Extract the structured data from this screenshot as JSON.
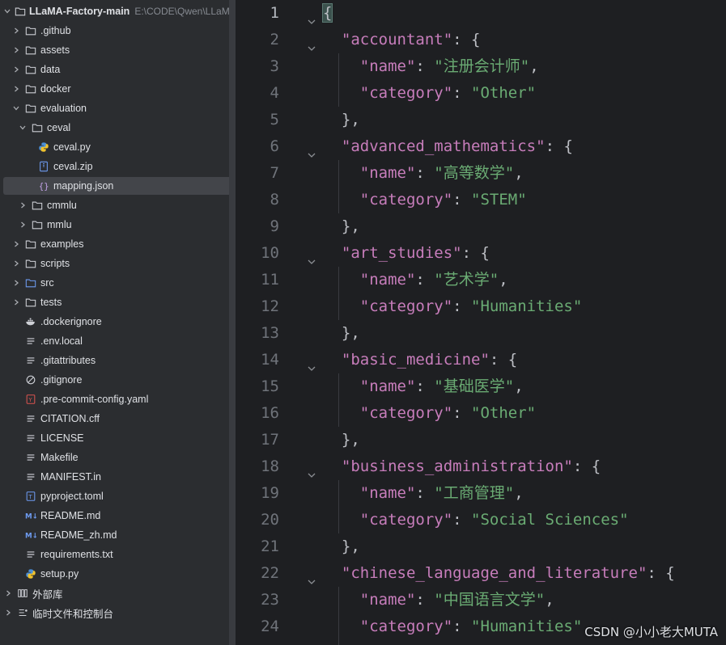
{
  "project": {
    "name": "LLaMA-Factory-main",
    "path": "E:\\CODE\\Qwen\\LLaMA"
  },
  "tree": [
    {
      "label": ".github",
      "type": "folder",
      "depth": 0,
      "expanded": false
    },
    {
      "label": "assets",
      "type": "folder",
      "depth": 0,
      "expanded": false
    },
    {
      "label": "data",
      "type": "folder",
      "depth": 0,
      "expanded": false
    },
    {
      "label": "docker",
      "type": "folder",
      "depth": 0,
      "expanded": false
    },
    {
      "label": "evaluation",
      "type": "folder",
      "depth": 0,
      "expanded": true
    },
    {
      "label": "ceval",
      "type": "folder",
      "depth": 1,
      "expanded": true
    },
    {
      "label": "ceval.py",
      "type": "python",
      "depth": 2
    },
    {
      "label": "ceval.zip",
      "type": "zip",
      "depth": 2
    },
    {
      "label": "mapping.json",
      "type": "json",
      "depth": 2,
      "selected": true
    },
    {
      "label": "cmmlu",
      "type": "folder",
      "depth": 1,
      "expanded": false
    },
    {
      "label": "mmlu",
      "type": "folder",
      "depth": 1,
      "expanded": false
    },
    {
      "label": "examples",
      "type": "folder",
      "depth": 0,
      "expanded": false
    },
    {
      "label": "scripts",
      "type": "folder",
      "depth": 0,
      "expanded": false
    },
    {
      "label": "src",
      "type": "folder-src",
      "depth": 0,
      "expanded": false
    },
    {
      "label": "tests",
      "type": "folder",
      "depth": 0,
      "expanded": false
    },
    {
      "label": ".dockerignore",
      "type": "docker",
      "depth": 0
    },
    {
      "label": ".env.local",
      "type": "text",
      "depth": 0
    },
    {
      "label": ".gitattributes",
      "type": "text",
      "depth": 0
    },
    {
      "label": ".gitignore",
      "type": "ignore",
      "depth": 0
    },
    {
      "label": ".pre-commit-config.yaml",
      "type": "yaml",
      "depth": 0
    },
    {
      "label": "CITATION.cff",
      "type": "text",
      "depth": 0
    },
    {
      "label": "LICENSE",
      "type": "text",
      "depth": 0
    },
    {
      "label": "Makefile",
      "type": "text",
      "depth": 0
    },
    {
      "label": "MANIFEST.in",
      "type": "text",
      "depth": 0
    },
    {
      "label": "pyproject.toml",
      "type": "toml",
      "depth": 0
    },
    {
      "label": "README.md",
      "type": "markdown",
      "depth": 0
    },
    {
      "label": "README_zh.md",
      "type": "markdown",
      "depth": 0
    },
    {
      "label": "requirements.txt",
      "type": "text",
      "depth": 0
    },
    {
      "label": "setup.py",
      "type": "python",
      "depth": 0
    }
  ],
  "external_libraries": "外部库",
  "scratches": "临时文件和控制台",
  "editor": {
    "lines": [
      {
        "n": "1",
        "fold": true,
        "tokens": [
          {
            "t": "{",
            "c": "hl"
          }
        ]
      },
      {
        "n": "2",
        "fold": true,
        "tokens": [
          {
            "t": "  "
          },
          {
            "t": "\"accountant\"",
            "c": "k"
          },
          {
            "t": ": {"
          }
        ]
      },
      {
        "n": "3",
        "tokens": [
          {
            "t": "    "
          },
          {
            "t": "\"name\"",
            "c": "k"
          },
          {
            "t": ": "
          },
          {
            "t": "\"注册会计师\"",
            "c": "s"
          },
          {
            "t": ","
          }
        ]
      },
      {
        "n": "4",
        "tokens": [
          {
            "t": "    "
          },
          {
            "t": "\"category\"",
            "c": "k"
          },
          {
            "t": ": "
          },
          {
            "t": "\"Other\"",
            "c": "s"
          }
        ]
      },
      {
        "n": "5",
        "tokens": [
          {
            "t": "  },"
          }
        ]
      },
      {
        "n": "6",
        "fold": true,
        "tokens": [
          {
            "t": "  "
          },
          {
            "t": "\"advanced_mathematics\"",
            "c": "k"
          },
          {
            "t": ": {"
          }
        ]
      },
      {
        "n": "7",
        "tokens": [
          {
            "t": "    "
          },
          {
            "t": "\"name\"",
            "c": "k"
          },
          {
            "t": ": "
          },
          {
            "t": "\"高等数学\"",
            "c": "s"
          },
          {
            "t": ","
          }
        ]
      },
      {
        "n": "8",
        "tokens": [
          {
            "t": "    "
          },
          {
            "t": "\"category\"",
            "c": "k"
          },
          {
            "t": ": "
          },
          {
            "t": "\"STEM\"",
            "c": "s"
          }
        ]
      },
      {
        "n": "9",
        "tokens": [
          {
            "t": "  },"
          }
        ]
      },
      {
        "n": "10",
        "fold": true,
        "tokens": [
          {
            "t": "  "
          },
          {
            "t": "\"art_studies\"",
            "c": "k"
          },
          {
            "t": ": {"
          }
        ]
      },
      {
        "n": "11",
        "tokens": [
          {
            "t": "    "
          },
          {
            "t": "\"name\"",
            "c": "k"
          },
          {
            "t": ": "
          },
          {
            "t": "\"艺术学\"",
            "c": "s"
          },
          {
            "t": ","
          }
        ]
      },
      {
        "n": "12",
        "tokens": [
          {
            "t": "    "
          },
          {
            "t": "\"category\"",
            "c": "k"
          },
          {
            "t": ": "
          },
          {
            "t": "\"Humanities\"",
            "c": "s"
          }
        ]
      },
      {
        "n": "13",
        "tokens": [
          {
            "t": "  },"
          }
        ]
      },
      {
        "n": "14",
        "fold": true,
        "tokens": [
          {
            "t": "  "
          },
          {
            "t": "\"basic_medicine\"",
            "c": "k"
          },
          {
            "t": ": {"
          }
        ]
      },
      {
        "n": "15",
        "tokens": [
          {
            "t": "    "
          },
          {
            "t": "\"name\"",
            "c": "k"
          },
          {
            "t": ": "
          },
          {
            "t": "\"基础医学\"",
            "c": "s"
          },
          {
            "t": ","
          }
        ]
      },
      {
        "n": "16",
        "tokens": [
          {
            "t": "    "
          },
          {
            "t": "\"category\"",
            "c": "k"
          },
          {
            "t": ": "
          },
          {
            "t": "\"Other\"",
            "c": "s"
          }
        ]
      },
      {
        "n": "17",
        "tokens": [
          {
            "t": "  },"
          }
        ]
      },
      {
        "n": "18",
        "fold": true,
        "tokens": [
          {
            "t": "  "
          },
          {
            "t": "\"business_administration\"",
            "c": "k"
          },
          {
            "t": ": {"
          }
        ]
      },
      {
        "n": "19",
        "tokens": [
          {
            "t": "    "
          },
          {
            "t": "\"name\"",
            "c": "k"
          },
          {
            "t": ": "
          },
          {
            "t": "\"工商管理\"",
            "c": "s"
          },
          {
            "t": ","
          }
        ]
      },
      {
        "n": "20",
        "tokens": [
          {
            "t": "    "
          },
          {
            "t": "\"category\"",
            "c": "k"
          },
          {
            "t": ": "
          },
          {
            "t": "\"Social Sciences\"",
            "c": "s"
          }
        ]
      },
      {
        "n": "21",
        "tokens": [
          {
            "t": "  },"
          }
        ]
      },
      {
        "n": "22",
        "fold": true,
        "tokens": [
          {
            "t": "  "
          },
          {
            "t": "\"chinese_language_and_literature\"",
            "c": "k"
          },
          {
            "t": ": {"
          }
        ]
      },
      {
        "n": "23",
        "tokens": [
          {
            "t": "    "
          },
          {
            "t": "\"name\"",
            "c": "k"
          },
          {
            "t": ": "
          },
          {
            "t": "\"中国语言文学\"",
            "c": "s"
          },
          {
            "t": ","
          }
        ]
      },
      {
        "n": "24",
        "tokens": [
          {
            "t": "    "
          },
          {
            "t": "\"category\"",
            "c": "k"
          },
          {
            "t": ": "
          },
          {
            "t": "\"Humanities\"",
            "c": "s"
          }
        ]
      }
    ]
  },
  "watermark": "CSDN @小小老大MUTA",
  "colors": {
    "key": "#c77dbb",
    "string": "#6aab73",
    "punct": "#bcbec4",
    "folder": "#9aa0a6",
    "python": "#4a90d9",
    "markdown": "#6e9cf2",
    "yaml": "#d9534f"
  }
}
